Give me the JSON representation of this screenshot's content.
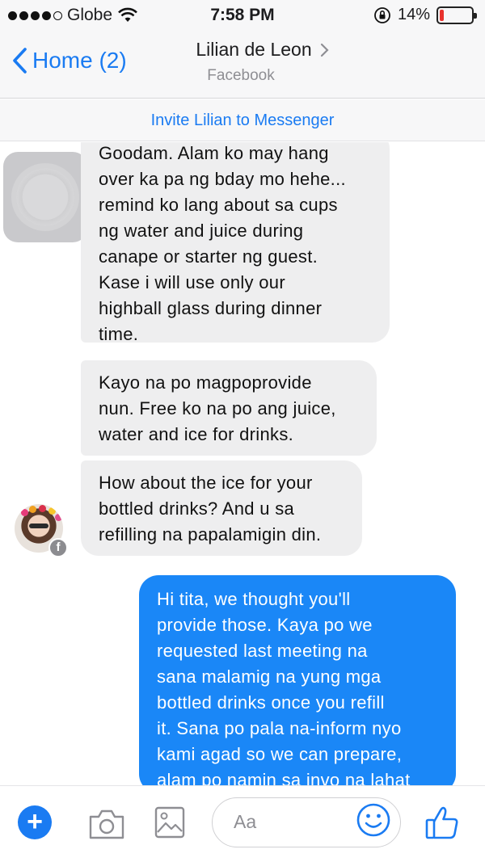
{
  "status_bar": {
    "carrier": "Globe",
    "time": "7:58 PM",
    "battery_percent": "14%",
    "battery_level": 0.14,
    "signal_bars_filled": 4,
    "signal_bars_total": 5,
    "icons": [
      "signal-dots-icon",
      "wifi-icon",
      "rotation-lock-icon",
      "battery-icon"
    ]
  },
  "nav": {
    "back_label": "Home (2)",
    "contact_name": "Lilian de Leon",
    "contact_subtitle": "Facebook"
  },
  "invite_banner": "Invite Lilian to Messenger",
  "messages": [
    {
      "direction": "incoming",
      "lines": [
        "Goodam. Alam ko may hang",
        "over ka pa ng bday mo hehe...",
        "remind ko lang about sa cups",
        "ng water and juice during",
        "canape or starter ng guest.",
        "Kase i will use only our",
        "highball glass during dinner",
        "time."
      ]
    },
    {
      "direction": "incoming",
      "lines": [
        "Kayo na po magpoprovide",
        "nun. Free ko na po ang juice,",
        "water and ice for drinks."
      ]
    },
    {
      "direction": "incoming",
      "lines": [
        "How about the ice for your",
        "bottled drinks? And u sa",
        "refilling na papalamigin din."
      ]
    },
    {
      "direction": "outgoing",
      "lines": [
        "Hi tita, we thought you'll",
        "provide those. Kaya po we",
        "requested  last meeting na",
        "sana malamig na yung mga",
        "bottled drinks once you refill",
        "it. Sana po pala na-inform nyo",
        "kami agad so we can prepare,",
        "alam po namin sa invo na lahat"
      ]
    }
  ],
  "composer": {
    "placeholder": "Aa",
    "icons": [
      "plus-icon",
      "camera-icon",
      "gallery-icon",
      "emoji-icon",
      "like-icon"
    ]
  },
  "colors": {
    "accent_blue": "#1a7bf2",
    "outgoing_bubble": "#1a87f7",
    "incoming_bubble": "#eeeeef",
    "battery_low": "#e8322d"
  }
}
